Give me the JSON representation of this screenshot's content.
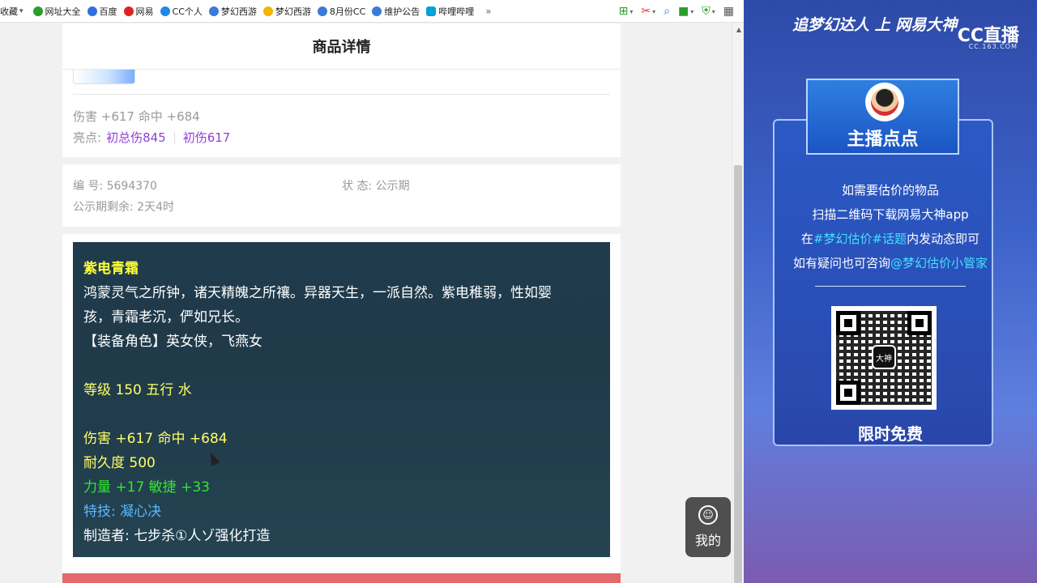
{
  "bookmarks": {
    "items": [
      {
        "label": "收藏",
        "icon": "star-icon",
        "color": "#f0a000"
      },
      {
        "label": "网址大全",
        "icon": "globe-icon",
        "color": "#2a9d2a"
      },
      {
        "label": "百度",
        "icon": "paw-icon",
        "color": "#2f6fe0"
      },
      {
        "label": "网易",
        "icon": "netease-icon",
        "color": "#d22"
      },
      {
        "label": "CC个人",
        "icon": "cc-icon",
        "color": "#1e88e5"
      },
      {
        "label": "梦幻西游",
        "icon": "game-icon",
        "color": "#3a7bd5"
      },
      {
        "label": "梦幻西游",
        "icon": "game-icon",
        "color": "#f2b400"
      },
      {
        "label": "8月份CC",
        "icon": "cc-icon",
        "color": "#3a7bd5"
      },
      {
        "label": "维护公告",
        "icon": "info-icon",
        "color": "#3a7bd5"
      },
      {
        "label": "哔哩哔哩",
        "icon": "tv-icon",
        "color": "#00a1d6"
      }
    ],
    "more": "»"
  },
  "header": {
    "title": "商品详情"
  },
  "stats": {
    "line1": "伤害 +617 命中 +684",
    "highlight_label": "亮点:",
    "highlight1": "初总伤845",
    "highlight2": "初伤617"
  },
  "info": {
    "id_text": "编 号: 5694370",
    "status_text": "状 态: 公示期",
    "remaining_text": "公示期剩余: 2天4时"
  },
  "item_desc": {
    "title": "紫电青霜",
    "lines": [
      "鸿蒙灵气之所钟，诸天精魄之所禳。异器天生，一派自然。紫电稚弱，性如婴",
      "孩，青霜老沉，俨如兄长。",
      "【装备角色】英女侠，飞燕女"
    ],
    "level": "等级 150 五行 水",
    "damage": "伤害 +617 命中 +684",
    "durability": "耐久度 500",
    "attrs": "力量 +17 敏捷 +33",
    "special": "特技: 凝心决",
    "maker": "制造者: 七步杀①人ゾ强化打造"
  },
  "float_button": {
    "label": "我的"
  },
  "overlay": {
    "banner": "追梦幻达人 上 网易大神",
    "cc_logo": "CC直播",
    "cc_sub": "CC.163.COM",
    "streamer_title": "主播点点",
    "line1": "如需要估价的物品",
    "line2": "扫描二维码下载网易大神app",
    "line3_pre": "在",
    "line3_topic": "#梦幻估价#话题",
    "line3_post": "内发动态即可",
    "line4_pre": "如有疑问也可咨询",
    "line4_at": "@梦幻估价小管家",
    "qr_logo": "大神",
    "free_label": "限时免费"
  }
}
